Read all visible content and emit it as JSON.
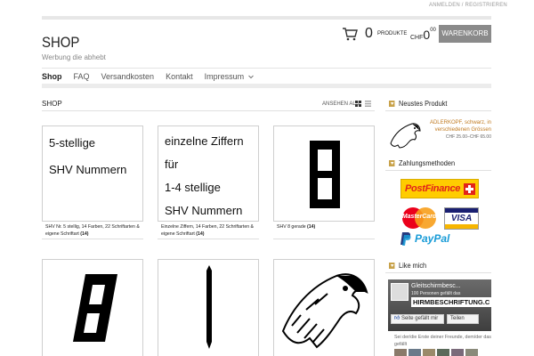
{
  "top_links": "ANMELDEN / REGISTRIEREN",
  "header": {
    "title": "SHOP",
    "tagline": "Werbung die abhebt"
  },
  "cart": {
    "count": "0",
    "label": "PRODUKTE",
    "currency": "CHF",
    "amount_int": "0",
    "amount_dec": "00",
    "button_label": "WARENKORB"
  },
  "nav": {
    "items": [
      {
        "label": "Shop",
        "active": true
      },
      {
        "label": "FAQ",
        "active": false
      },
      {
        "label": "Versandkosten",
        "active": false
      },
      {
        "label": "Kontakt",
        "active": false
      },
      {
        "label": "Impressum",
        "active": false,
        "dropdown": true
      }
    ]
  },
  "content": {
    "title": "SHOP",
    "view_as": "ANSEHEN ALS"
  },
  "products": [
    {
      "thumb_lines": [
        "5-stellige",
        "SHV Nummern"
      ],
      "caption": "SHV Nr. 5 stellig, 14 Farben, 22 Schriftarten & eigene Schriftart",
      "count": "(14)"
    },
    {
      "thumb_lines": [
        "einzelne Ziffern",
        "für",
        "1-4 stellige",
        "SHV Nummern"
      ],
      "caption": "Einzelne Ziffern, 14 Farben, 22 Schriftarten & eigene Schriftart",
      "count": "(14)"
    },
    {
      "thumb_lines": [],
      "caption": "SHV 8 gerade",
      "count": "(14)"
    }
  ],
  "sidebar": {
    "newest": {
      "heading": "Neustes Produkt",
      "name": "ADLERKOPF, schwarz, in verschiedenen Grössen",
      "price": "CHF 25.00–CHF 65.00"
    },
    "payment": {
      "heading": "Zahlungsmethoden",
      "methods": [
        "PostFinance",
        "MasterCard",
        "VISA",
        "PayPal"
      ]
    },
    "like": {
      "heading": "Like mich",
      "page_name": "Gleitschirmbesc...",
      "page_sub": "100 Personen gefällt das",
      "banner": "HIRMBESCHRIFTUNG.C",
      "like_button": "Seite gefällt mir",
      "share_button": "Teilen",
      "friends_text": "Sei der/die Erste deiner Freunde, dem/der das gefällt"
    }
  },
  "colors": {
    "accent_gold": "#c8a24a",
    "product_link": "#c07a20",
    "button_grey": "#8a8a8a",
    "postfinance_yellow": "#ffcc00",
    "postfinance_red": "#e2231a",
    "visa_blue": "#1a1f71",
    "paypal_dark": "#253b80",
    "paypal_light": "#179bd7"
  }
}
